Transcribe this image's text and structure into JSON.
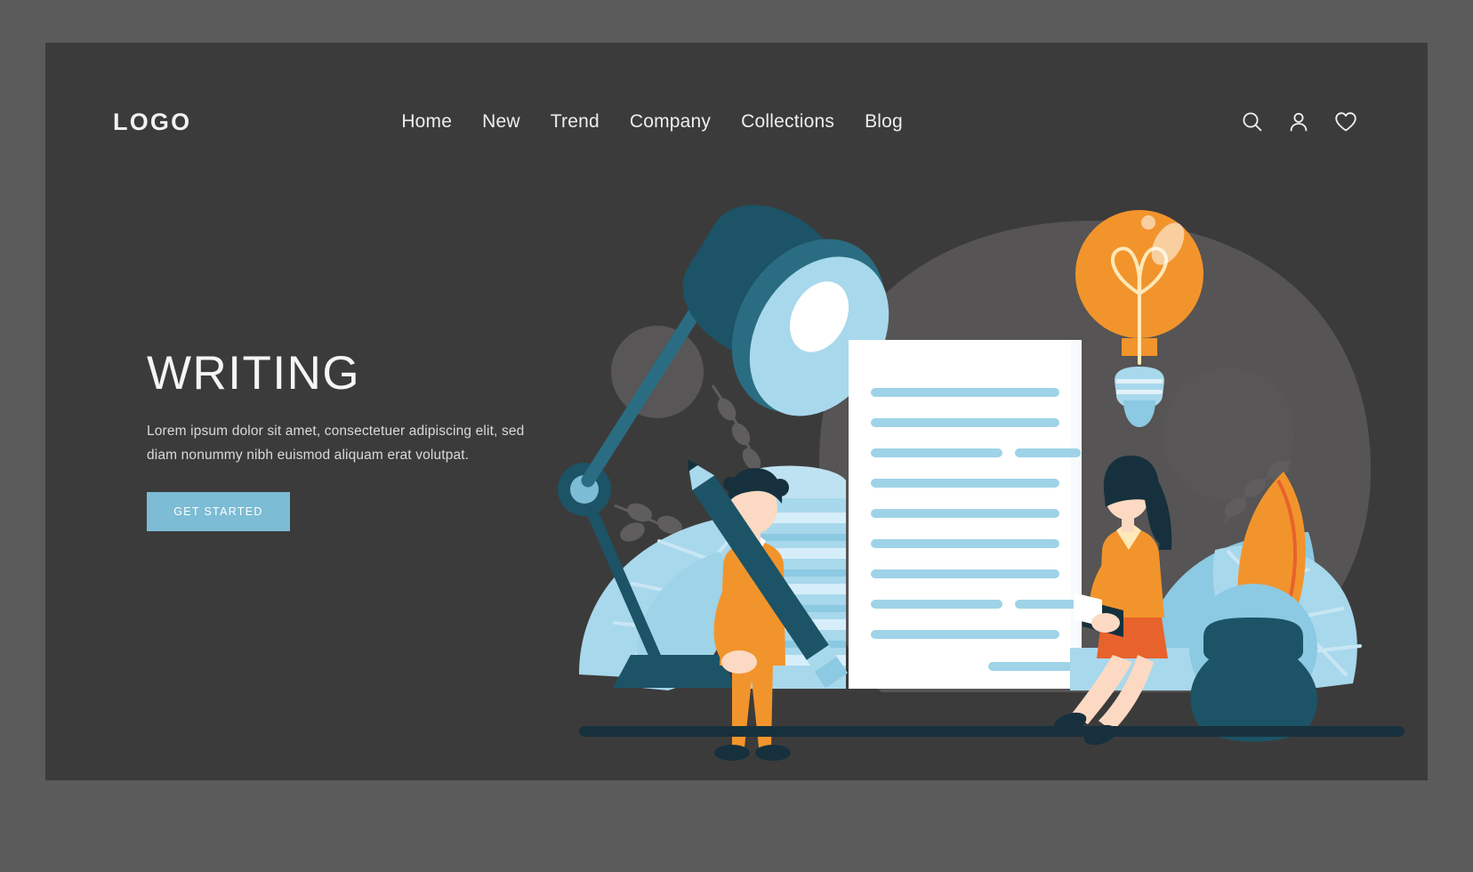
{
  "brand": {
    "logo": "LOGO"
  },
  "nav": {
    "items": [
      {
        "label": "Home"
      },
      {
        "label": "New"
      },
      {
        "label": "Trend"
      },
      {
        "label": "Company"
      },
      {
        "label": "Collections"
      },
      {
        "label": "Blog"
      }
    ]
  },
  "header_icons": [
    {
      "name": "search-icon"
    },
    {
      "name": "user-icon"
    },
    {
      "name": "heart-icon"
    }
  ],
  "hero": {
    "title": "WRITING",
    "description": "Lorem ipsum dolor sit amet, consectetuer adipiscing elit, sed diam nonummy nibh euismod aliquam erat volutpat.",
    "cta_label": "GET STARTED"
  },
  "illustration": {
    "alt": "Person writing with giant pencil on a lined document, desk lamp, stack of papers, woman reading on ledge, light bulb, quill feather in inkwell, leaves",
    "elements": [
      "desk-lamp",
      "paper-stack",
      "lined-document",
      "person-with-pencil",
      "woman-reading",
      "light-bulb",
      "feather-quill",
      "inkwell",
      "leaves",
      "ground-line"
    ]
  },
  "colors": {
    "page_background": "#5b5b5b",
    "panel_background": "#3c3b3b",
    "blob_background": "#565454",
    "accent_button": "#7cbcd4",
    "accent_orange": "#f2942c",
    "dark_teal": "#1c5366",
    "light_blue": "#a8d8ec",
    "mid_blue": "#8cc9e2",
    "text_primary": "#f5f5f5",
    "text_secondary": "#d9d9d9",
    "paper_white": "#ffffff",
    "line_blue": "#9ed3e8"
  }
}
